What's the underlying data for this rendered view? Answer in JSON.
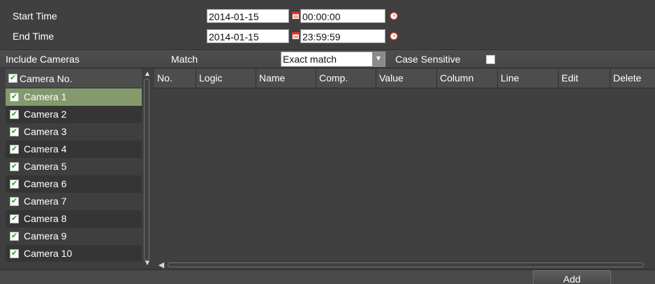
{
  "time": {
    "start_label": "Start Time",
    "start_date": "2014-01-15",
    "start_time": "00:00:00",
    "end_label": "End Time",
    "end_date": "2014-01-15",
    "end_time": "23:59:59"
  },
  "filter_bar": {
    "include_label": "Include Cameras",
    "match_label": "Match",
    "match_value": "Exact match",
    "case_label": "Case Sensitive",
    "case_checked": false
  },
  "cameras": {
    "header": "Camera No.",
    "header_checked": true,
    "selected_index": 0,
    "items": [
      {
        "label": "Camera 1",
        "checked": true
      },
      {
        "label": "Camera 2",
        "checked": true
      },
      {
        "label": "Camera 3",
        "checked": true
      },
      {
        "label": "Camera 4",
        "checked": true
      },
      {
        "label": "Camera 5",
        "checked": true
      },
      {
        "label": "Camera 6",
        "checked": true
      },
      {
        "label": "Camera 7",
        "checked": true
      },
      {
        "label": "Camera 8",
        "checked": true
      },
      {
        "label": "Camera 9",
        "checked": true
      },
      {
        "label": "Camera 10",
        "checked": true
      }
    ]
  },
  "table": {
    "columns": [
      "No.",
      "Logic",
      "Name",
      "Comp.",
      "Value",
      "Column",
      "Line",
      "Edit",
      "Delete"
    ],
    "rows": []
  },
  "actions": {
    "add_label": "Add"
  },
  "icons": {
    "calendar": "calendar-icon",
    "clock": "clock-icon",
    "checkmark": "checkmark-icon",
    "chevron_up": "chevron-up-icon",
    "chevron_down": "chevron-down-icon",
    "chevron_left": "chevron-left-icon",
    "dropdown": "dropdown-arrow-icon"
  },
  "colors": {
    "background": "#3f3f3f",
    "selected_row": "#849a6d",
    "check_green": "#2c9a2c"
  }
}
